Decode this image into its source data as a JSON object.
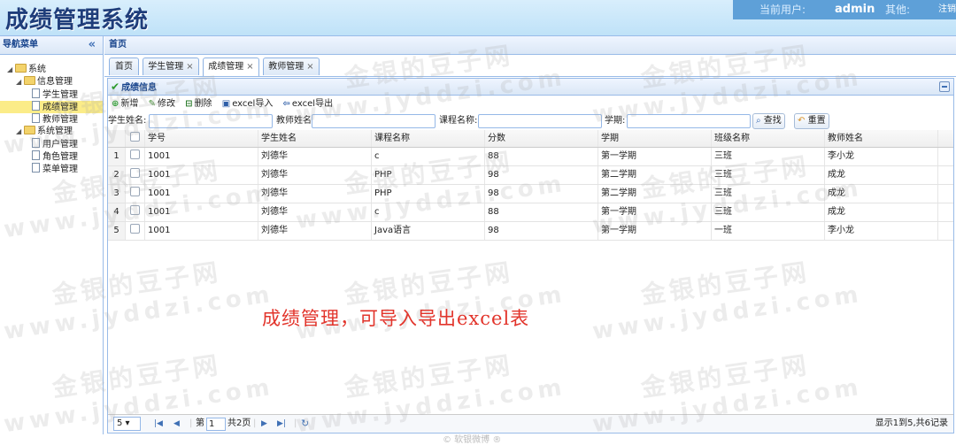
{
  "app": {
    "title": "成绩管理系统",
    "current_user_label": "当前用户:",
    "username": "admin",
    "other_label": "其他:",
    "logout": "注销"
  },
  "west": {
    "title": "导航菜单",
    "collapse_icon": "double-chevron-left-icon",
    "tree": [
      {
        "label": "系统",
        "level": 0,
        "type": "folder"
      },
      {
        "label": "信息管理",
        "level": 1,
        "type": "folder"
      },
      {
        "label": "学生管理",
        "level": 2,
        "type": "file"
      },
      {
        "label": "成绩管理",
        "level": 2,
        "type": "file",
        "selected": true
      },
      {
        "label": "教师管理",
        "level": 2,
        "type": "file"
      },
      {
        "label": "系统管理",
        "level": 1,
        "type": "folder"
      },
      {
        "label": "用户管理",
        "level": 2,
        "type": "file"
      },
      {
        "label": "角色管理",
        "level": 2,
        "type": "file"
      },
      {
        "label": "菜单管理",
        "level": 2,
        "type": "file"
      }
    ]
  },
  "center": {
    "title": "首页",
    "tabs": [
      {
        "label": "首页",
        "closable": false
      },
      {
        "label": "学生管理",
        "closable": true
      },
      {
        "label": "成绩管理",
        "closable": true,
        "active": true
      },
      {
        "label": "教师管理",
        "closable": true
      }
    ],
    "close_glyph": "×"
  },
  "panel": {
    "title": "成绩信息",
    "toolbar": {
      "add": "新增",
      "edit": "修改",
      "delete": "删除",
      "import": "excel导入",
      "export": "excel导出"
    },
    "search": {
      "student_name_label": "学生姓名:",
      "teacher_name_label": "教师姓名:",
      "course_name_label": "课程名称:",
      "term_label": "学期:",
      "search_button": "查找",
      "reset_button": "重置"
    },
    "grid": {
      "columns": [
        "学号",
        "学生姓名",
        "课程名称",
        "分数",
        "学期",
        "班级名称",
        "教师姓名"
      ],
      "rows": [
        {
          "num": "1",
          "cells": [
            "1001",
            "刘德华",
            "c",
            "88",
            "第一学期",
            "三班",
            "李小龙"
          ]
        },
        {
          "num": "2",
          "cells": [
            "1001",
            "刘德华",
            "PHP",
            "98",
            "第二学期",
            "三班",
            "成龙"
          ]
        },
        {
          "num": "3",
          "cells": [
            "1001",
            "刘德华",
            "PHP",
            "98",
            "第二学期",
            "三班",
            "成龙"
          ]
        },
        {
          "num": "4",
          "cells": [
            "1001",
            "刘德华",
            "c",
            "88",
            "第一学期",
            "三班",
            "成龙"
          ]
        },
        {
          "num": "5",
          "cells": [
            "1001",
            "刘德华",
            "Java语言",
            "98",
            "第一学期",
            "一班",
            "李小龙"
          ]
        }
      ]
    },
    "pager": {
      "page_size": "5",
      "page_label": "第",
      "page_value": "1",
      "total_pages": "共2页",
      "summary": "显示1到5,共6记录"
    }
  },
  "annotation": "成绩管理，可导入导出excel表",
  "footer": "© 软银微博 ®",
  "watermark": {
    "line1": "金银的豆子网",
    "line2": "www.jyddzi.com"
  },
  "colors": {
    "header_bg": "#bfe2f8",
    "userbar_bg": "#5ea0d8",
    "title_color": "#1f3d7a",
    "selected_node": "#fbec88",
    "annotation_red": "#e2342b"
  }
}
